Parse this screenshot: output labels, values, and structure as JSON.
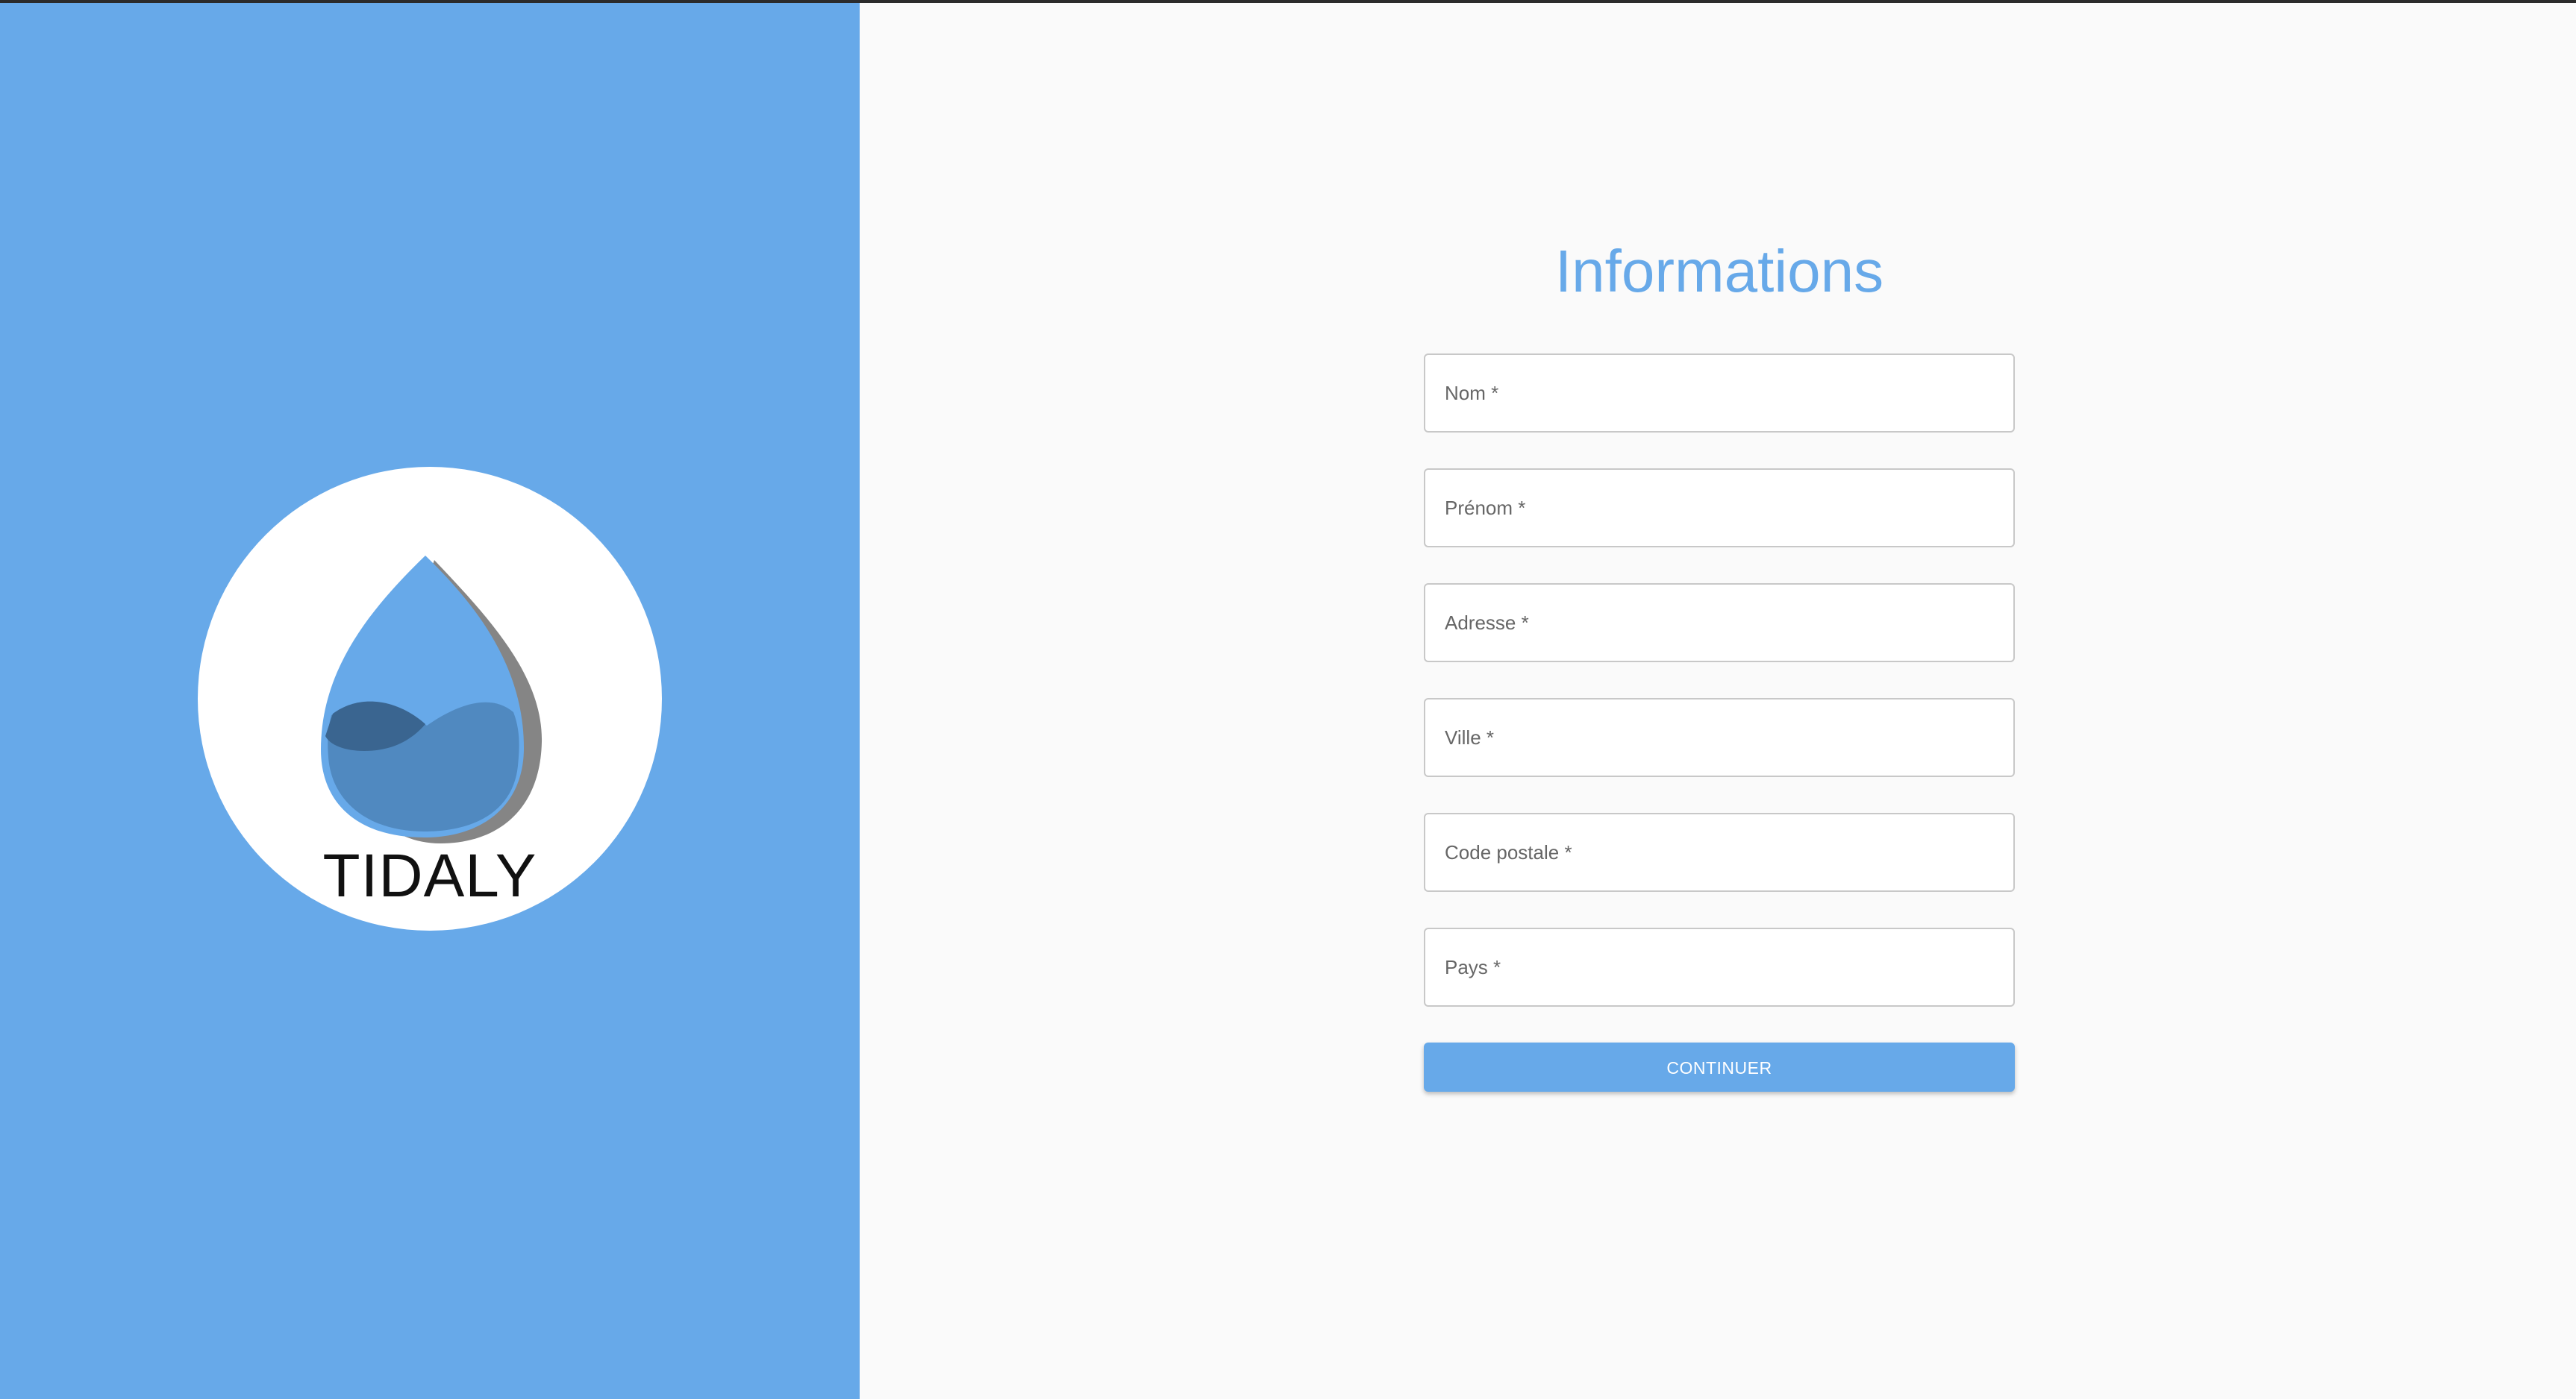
{
  "logo": {
    "text": "TIDALY",
    "colors": {
      "drop_outline": "#67a9e9",
      "drop_fill": "#5089c0",
      "wave_dark": "#3a6590",
      "shadow": "#858585"
    }
  },
  "form": {
    "title": "Informations",
    "fields": [
      {
        "label": "Nom *",
        "value": ""
      },
      {
        "label": "Prénom *",
        "value": ""
      },
      {
        "label": "Adresse *",
        "value": ""
      },
      {
        "label": "Ville *",
        "value": ""
      },
      {
        "label": "Code postale *",
        "value": ""
      },
      {
        "label": "Pays *",
        "value": ""
      }
    ],
    "continue_label": "CONTINUER"
  },
  "colors": {
    "accent": "#67a9e9",
    "background": "#fafafa",
    "field_border": "#c8c8c8"
  }
}
